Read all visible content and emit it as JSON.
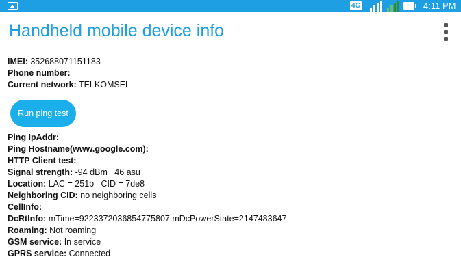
{
  "status_bar": {
    "network_type": "4G",
    "time": "4:11 PM",
    "icons": [
      "gallery-icon",
      "signal-4g-icon",
      "signal-icon",
      "battery-icon"
    ]
  },
  "app_bar": {
    "title": "Handheld mobile device info",
    "menu_icon": "overflow-menu-icon"
  },
  "device_info": {
    "imei_label": "IMEI:",
    "imei_value": "352688071151183",
    "phone_label": "Phone number:",
    "phone_value": "",
    "network_label": "Current network:",
    "network_value": "TELKOMSEL"
  },
  "ping_button_label": "Run ping test",
  "details": [
    {
      "label": "Ping IpAddr:",
      "value": ""
    },
    {
      "label": "Ping Hostname(www.google.com):",
      "value": ""
    },
    {
      "label": "HTTP Client test:",
      "value": ""
    },
    {
      "label": "Signal strength:",
      "value": "-94 dBm   46 asu"
    },
    {
      "label": "Location:",
      "value": "LAC = 251b   CID = 7de8"
    },
    {
      "label": "Neighboring CID:",
      "value": "no neighboring cells"
    },
    {
      "label": "CellInfo:",
      "value": ""
    },
    {
      "label": "DcRtInfo:",
      "value": "mTime=9223372036854775807 mDcPowerState=2147483647"
    },
    {
      "label": "Roaming:",
      "value": "Not roaming"
    },
    {
      "label": "GSM service:",
      "value": "In service"
    },
    {
      "label": "GPRS service:",
      "value": "Connected"
    }
  ],
  "colors": {
    "accent": "#1e9fe3",
    "button": "#1aaeea",
    "text": "#111111"
  }
}
